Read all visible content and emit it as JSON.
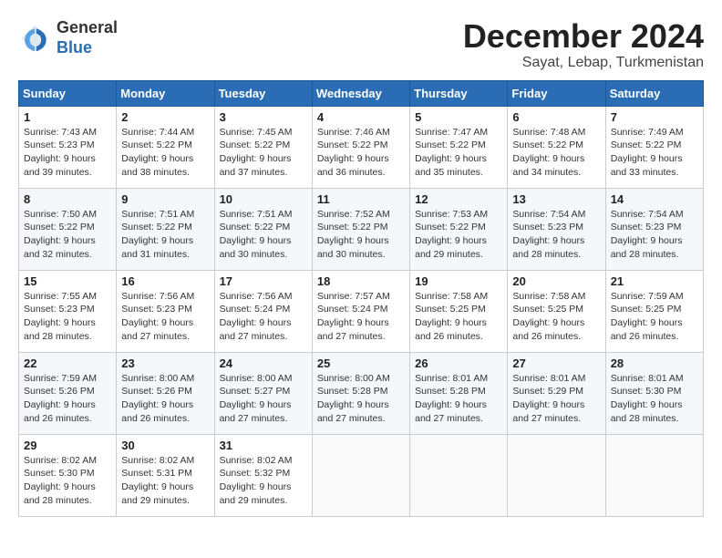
{
  "logo": {
    "general": "General",
    "blue": "Blue"
  },
  "header": {
    "month": "December 2024",
    "location": "Sayat, Lebap, Turkmenistan"
  },
  "weekdays": [
    "Sunday",
    "Monday",
    "Tuesday",
    "Wednesday",
    "Thursday",
    "Friday",
    "Saturday"
  ],
  "weeks": [
    [
      {
        "day": 1,
        "sunrise": "7:43 AM",
        "sunset": "5:23 PM",
        "daylight": "9 hours and 39 minutes."
      },
      {
        "day": 2,
        "sunrise": "7:44 AM",
        "sunset": "5:22 PM",
        "daylight": "9 hours and 38 minutes."
      },
      {
        "day": 3,
        "sunrise": "7:45 AM",
        "sunset": "5:22 PM",
        "daylight": "9 hours and 37 minutes."
      },
      {
        "day": 4,
        "sunrise": "7:46 AM",
        "sunset": "5:22 PM",
        "daylight": "9 hours and 36 minutes."
      },
      {
        "day": 5,
        "sunrise": "7:47 AM",
        "sunset": "5:22 PM",
        "daylight": "9 hours and 35 minutes."
      },
      {
        "day": 6,
        "sunrise": "7:48 AM",
        "sunset": "5:22 PM",
        "daylight": "9 hours and 34 minutes."
      },
      {
        "day": 7,
        "sunrise": "7:49 AM",
        "sunset": "5:22 PM",
        "daylight": "9 hours and 33 minutes."
      }
    ],
    [
      {
        "day": 8,
        "sunrise": "7:50 AM",
        "sunset": "5:22 PM",
        "daylight": "9 hours and 32 minutes."
      },
      {
        "day": 9,
        "sunrise": "7:51 AM",
        "sunset": "5:22 PM",
        "daylight": "9 hours and 31 minutes."
      },
      {
        "day": 10,
        "sunrise": "7:51 AM",
        "sunset": "5:22 PM",
        "daylight": "9 hours and 30 minutes."
      },
      {
        "day": 11,
        "sunrise": "7:52 AM",
        "sunset": "5:22 PM",
        "daylight": "9 hours and 30 minutes."
      },
      {
        "day": 12,
        "sunrise": "7:53 AM",
        "sunset": "5:22 PM",
        "daylight": "9 hours and 29 minutes."
      },
      {
        "day": 13,
        "sunrise": "7:54 AM",
        "sunset": "5:23 PM",
        "daylight": "9 hours and 28 minutes."
      },
      {
        "day": 14,
        "sunrise": "7:54 AM",
        "sunset": "5:23 PM",
        "daylight": "9 hours and 28 minutes."
      }
    ],
    [
      {
        "day": 15,
        "sunrise": "7:55 AM",
        "sunset": "5:23 PM",
        "daylight": "9 hours and 28 minutes."
      },
      {
        "day": 16,
        "sunrise": "7:56 AM",
        "sunset": "5:23 PM",
        "daylight": "9 hours and 27 minutes."
      },
      {
        "day": 17,
        "sunrise": "7:56 AM",
        "sunset": "5:24 PM",
        "daylight": "9 hours and 27 minutes."
      },
      {
        "day": 18,
        "sunrise": "7:57 AM",
        "sunset": "5:24 PM",
        "daylight": "9 hours and 27 minutes."
      },
      {
        "day": 19,
        "sunrise": "7:58 AM",
        "sunset": "5:25 PM",
        "daylight": "9 hours and 26 minutes."
      },
      {
        "day": 20,
        "sunrise": "7:58 AM",
        "sunset": "5:25 PM",
        "daylight": "9 hours and 26 minutes."
      },
      {
        "day": 21,
        "sunrise": "7:59 AM",
        "sunset": "5:25 PM",
        "daylight": "9 hours and 26 minutes."
      }
    ],
    [
      {
        "day": 22,
        "sunrise": "7:59 AM",
        "sunset": "5:26 PM",
        "daylight": "9 hours and 26 minutes."
      },
      {
        "day": 23,
        "sunrise": "8:00 AM",
        "sunset": "5:26 PM",
        "daylight": "9 hours and 26 minutes."
      },
      {
        "day": 24,
        "sunrise": "8:00 AM",
        "sunset": "5:27 PM",
        "daylight": "9 hours and 27 minutes."
      },
      {
        "day": 25,
        "sunrise": "8:00 AM",
        "sunset": "5:28 PM",
        "daylight": "9 hours and 27 minutes."
      },
      {
        "day": 26,
        "sunrise": "8:01 AM",
        "sunset": "5:28 PM",
        "daylight": "9 hours and 27 minutes."
      },
      {
        "day": 27,
        "sunrise": "8:01 AM",
        "sunset": "5:29 PM",
        "daylight": "9 hours and 27 minutes."
      },
      {
        "day": 28,
        "sunrise": "8:01 AM",
        "sunset": "5:30 PM",
        "daylight": "9 hours and 28 minutes."
      }
    ],
    [
      {
        "day": 29,
        "sunrise": "8:02 AM",
        "sunset": "5:30 PM",
        "daylight": "9 hours and 28 minutes."
      },
      {
        "day": 30,
        "sunrise": "8:02 AM",
        "sunset": "5:31 PM",
        "daylight": "9 hours and 29 minutes."
      },
      {
        "day": 31,
        "sunrise": "8:02 AM",
        "sunset": "5:32 PM",
        "daylight": "9 hours and 29 minutes."
      },
      null,
      null,
      null,
      null
    ]
  ]
}
